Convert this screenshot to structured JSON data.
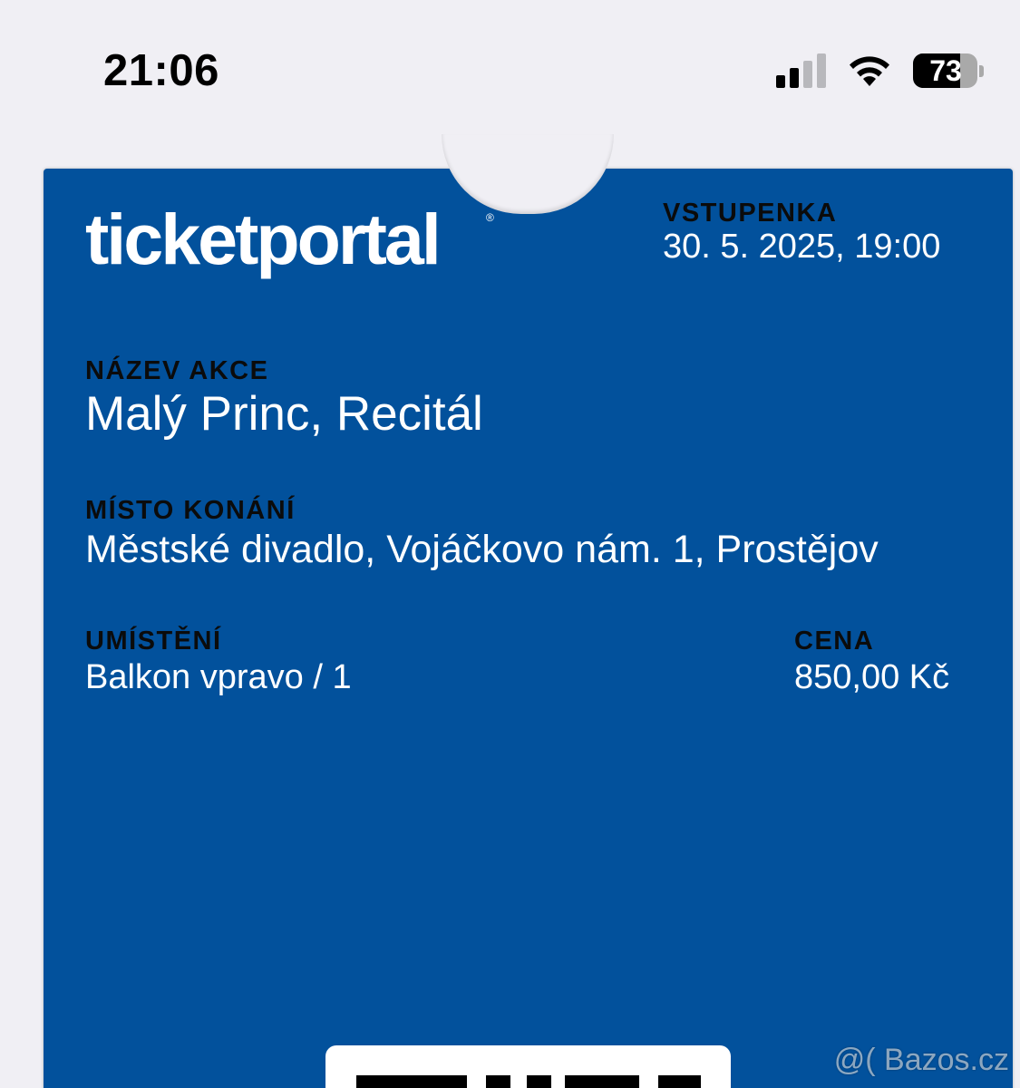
{
  "status_bar": {
    "time": "21:06",
    "battery_percent": "73",
    "signal_bars_active": 2,
    "signal_bars_total": 4,
    "icons": [
      "cellular-signal-icon",
      "wifi-icon",
      "battery-icon"
    ]
  },
  "ticket": {
    "brand": "ticketportal",
    "brand_mark": "®",
    "header_label": "VSTUPENKA",
    "datetime": "30. 5. 2025, 19:00",
    "event_label": "NÁZEV AKCE",
    "event_name": "Malý Princ, Recitál",
    "venue_label": "MÍSTO KONÁNÍ",
    "venue": "Městské divadlo, Vojáčkovo nám. 1, Prostějov",
    "seat_label": "UMÍSTĚNÍ",
    "seat": "Balkon vpravo / 1",
    "price_label": "CENA",
    "price": "850,00 Kč"
  },
  "watermark": "@( Bazos.cz",
  "colors": {
    "pass_background": "#02519c",
    "label_text": "#0b0b0b",
    "value_text": "#ffffff",
    "screen_background": "#f0eff4"
  }
}
